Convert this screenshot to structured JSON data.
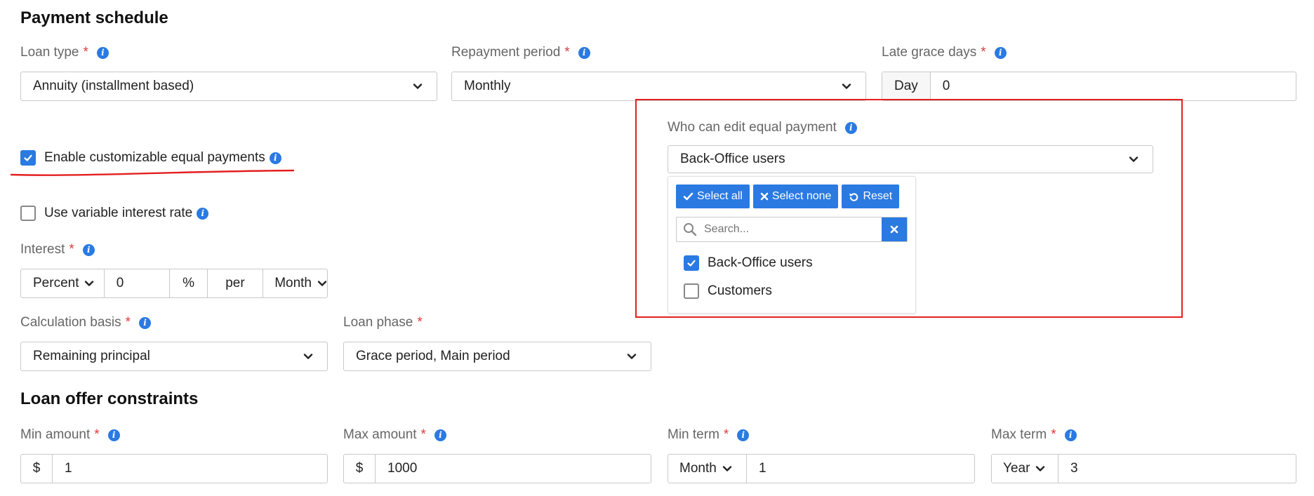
{
  "payment_schedule": {
    "heading": "Payment schedule",
    "loan_type": {
      "label": "Loan type",
      "value": "Annuity (installment based)"
    },
    "repayment_period": {
      "label": "Repayment period",
      "value": "Monthly"
    },
    "late_grace_days": {
      "label": "Late grace days",
      "unit": "Day",
      "value": "0"
    },
    "enable_custom_equal": {
      "label": "Enable customizable equal payments",
      "checked": true
    },
    "variable_interest": {
      "label": "Use variable interest rate",
      "checked": false
    },
    "interest": {
      "label": "Interest",
      "type": "Percent",
      "value": "0",
      "symbol": "%",
      "per": "per",
      "period": "Month"
    },
    "calculation_basis": {
      "label": "Calculation basis",
      "value": "Remaining principal"
    },
    "loan_phase": {
      "label": "Loan phase",
      "value": "Grace period, Main period"
    },
    "required_mark": "*"
  },
  "who_can_edit": {
    "label": "Who can edit equal payment",
    "value": "Back-Office users",
    "dropdown": {
      "select_all": "Select all",
      "select_none": "Select none",
      "reset": "Reset",
      "search_placeholder": "Search...",
      "options": [
        {
          "label": "Back-Office users",
          "checked": true
        },
        {
          "label": "Customers",
          "checked": false
        }
      ]
    }
  },
  "loan_offer_constraints": {
    "heading": "Loan offer constraints",
    "min_amount": {
      "label": "Min amount",
      "currency": "$",
      "value": "1"
    },
    "max_amount": {
      "label": "Max amount",
      "currency": "$",
      "value": "1000"
    },
    "min_term": {
      "label": "Min term",
      "unit": "Month",
      "value": "1"
    },
    "max_term": {
      "label": "Max term",
      "unit": "Year",
      "value": "3"
    }
  },
  "colors": {
    "accent": "#2a7ae2",
    "required": "#e03b3b",
    "highlight": "#e41f1f"
  }
}
